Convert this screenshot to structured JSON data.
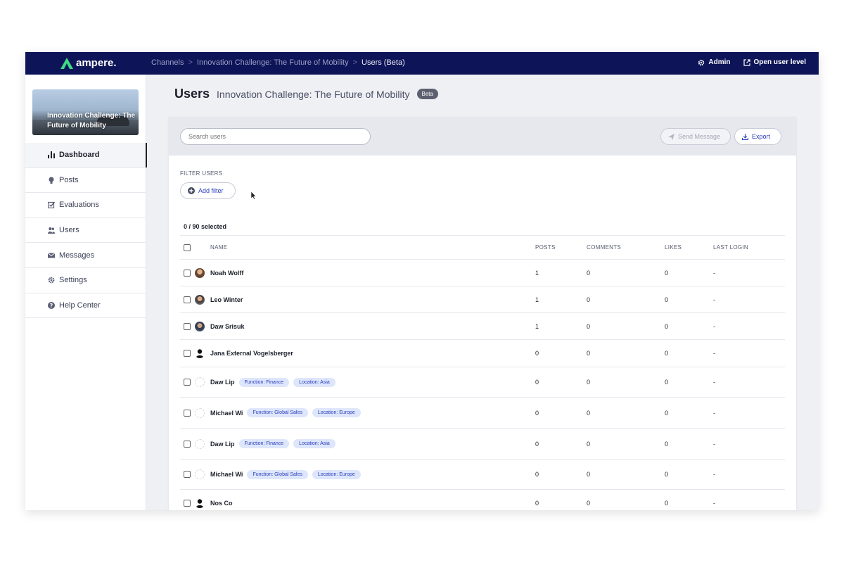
{
  "brand": {
    "name": "ampere."
  },
  "breadcrumb": [
    "Channels",
    "Innovation Challenge: The Future of Mobility",
    "Users (Beta)"
  ],
  "topbar": {
    "admin_label": "Admin",
    "open_user_level_label": "Open user level"
  },
  "sidebar": {
    "banner_text": "Innovation Challenge: The Future of Mobility",
    "items": [
      {
        "label": "Dashboard",
        "icon": "bar-chart-icon",
        "active": true
      },
      {
        "label": "Posts",
        "icon": "lightbulb-icon",
        "active": false
      },
      {
        "label": "Evaluations",
        "icon": "checkbox-icon",
        "active": false
      },
      {
        "label": "Users",
        "icon": "users-icon",
        "active": false
      },
      {
        "label": "Messages",
        "icon": "envelope-icon",
        "active": false
      },
      {
        "label": "Settings",
        "icon": "gear-icon",
        "active": false
      },
      {
        "label": "Help Center",
        "icon": "question-icon",
        "active": false
      }
    ]
  },
  "page": {
    "title": "Users",
    "subtitle": "Innovation Challenge: The Future of Mobility",
    "badge": "Beta"
  },
  "toolbar": {
    "search_placeholder": "Search users",
    "send_message_label": "Send Message",
    "export_label": "Export"
  },
  "filters": {
    "label": "FILTER USERS",
    "add_filter_label": "Add filter"
  },
  "selection": {
    "text": "0 / 90 selected"
  },
  "table": {
    "headers": {
      "name": "NAME",
      "posts": "POSTS",
      "comments": "COMMENTS",
      "likes": "LIKES",
      "last_login": "LAST LOGIN"
    },
    "rows": [
      {
        "name": "Noah Wolff",
        "avatar": "photo",
        "tags": [],
        "posts": "1",
        "comments": "0",
        "likes": "0",
        "last_login": "-"
      },
      {
        "name": "Leo Winter",
        "avatar": "photo",
        "tags": [],
        "posts": "1",
        "comments": "0",
        "likes": "0",
        "last_login": "-"
      },
      {
        "name": "Daw Srisuk",
        "avatar": "photo",
        "tags": [],
        "posts": "1",
        "comments": "0",
        "likes": "0",
        "last_login": "-"
      },
      {
        "name": "Jana External Vogelsberger",
        "avatar": "silhouette",
        "tags": [],
        "posts": "0",
        "comments": "0",
        "likes": "0",
        "last_login": "-"
      },
      {
        "name": "Daw Lip",
        "avatar": "blank",
        "tags": [
          "Function: Finance",
          "Location: Asia"
        ],
        "posts": "0",
        "comments": "0",
        "likes": "0",
        "last_login": "-"
      },
      {
        "name": "Michael Wi",
        "avatar": "blank",
        "tags": [
          "Function: Global Sales",
          "Location: Europe"
        ],
        "posts": "0",
        "comments": "0",
        "likes": "0",
        "last_login": "-"
      },
      {
        "name": "Daw Lip",
        "avatar": "blank",
        "tags": [
          "Function: Finance",
          "Location: Asia"
        ],
        "posts": "0",
        "comments": "0",
        "likes": "0",
        "last_login": "-"
      },
      {
        "name": "Michael Wi",
        "avatar": "blank",
        "tags": [
          "Function: Global Sales",
          "Location: Europe"
        ],
        "posts": "0",
        "comments": "0",
        "likes": "0",
        "last_login": "-"
      },
      {
        "name": "Nos Co",
        "avatar": "silhouette",
        "tags": [],
        "posts": "0",
        "comments": "0",
        "likes": "0",
        "last_login": "-"
      }
    ]
  },
  "colors": {
    "topbar": "#0e1458",
    "accent": "#2a3dbd",
    "tag_bg": "#dde6fb"
  }
}
